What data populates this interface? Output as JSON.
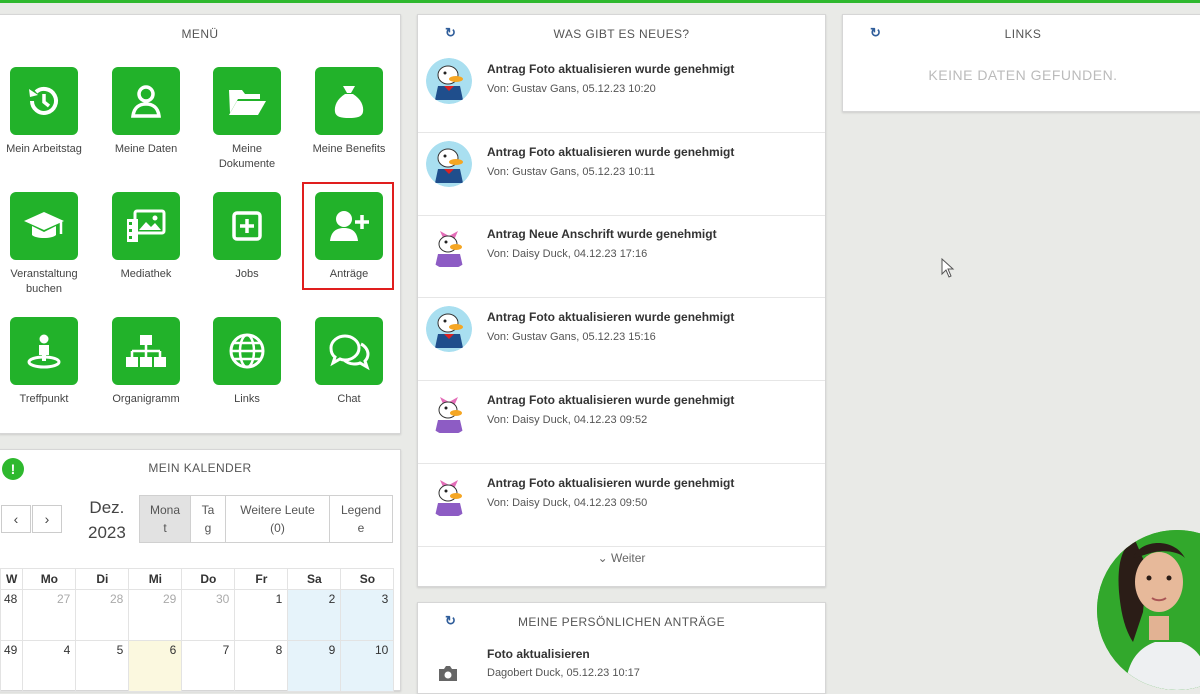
{
  "menu": {
    "title": "MENÜ",
    "items": [
      {
        "label": "Mein Arbeitstag",
        "icon": "history-icon"
      },
      {
        "label": "Meine Daten",
        "icon": "user-icon"
      },
      {
        "label": "Meine\nDokumente",
        "icon": "folder-icon"
      },
      {
        "label": "Meine Benefits",
        "icon": "money-bag-icon"
      },
      {
        "label": "Veranstaltung\nbuchen",
        "icon": "graduation-cap-icon"
      },
      {
        "label": "Mediathek",
        "icon": "media-icon"
      },
      {
        "label": "Jobs",
        "icon": "plus-square-icon"
      },
      {
        "label": "Anträge",
        "icon": "user-plus-icon"
      },
      {
        "label": "Treffpunkt",
        "icon": "meeting-point-icon"
      },
      {
        "label": "Organigramm",
        "icon": "org-chart-icon"
      },
      {
        "label": "Links",
        "icon": "globe-icon"
      },
      {
        "label": "Chat",
        "icon": "chat-icon"
      }
    ],
    "highlighted": "Anträge"
  },
  "calendar": {
    "title": "MEIN KALENDER",
    "info": "!",
    "prev": "‹",
    "next": "›",
    "month": "Dez.",
    "year": "2023",
    "views": {
      "monat": "Mona\nt",
      "tag": "Ta\ng",
      "weitere": "Weitere Leute\n(0)",
      "legende": "Legend\ne"
    },
    "headers": [
      "W",
      "Mo",
      "Di",
      "Mi",
      "Do",
      "Fr",
      "Sa",
      "So"
    ],
    "weeks": [
      [
        "48",
        "27",
        "28",
        "29",
        "30",
        "1",
        "2",
        "3"
      ],
      [
        "49",
        "4",
        "5",
        "6",
        "7",
        "8",
        "9",
        "10"
      ]
    ]
  },
  "news": {
    "title": "WAS GIBT ES NEUES?",
    "items": [
      {
        "title": "Antrag Foto aktualisieren wurde genehmigt",
        "sub": "Von: Gustav Gans, 05.12.23 10:20",
        "avatar": "gustav-avatar-icon"
      },
      {
        "title": "Antrag Foto aktualisieren wurde genehmigt",
        "sub": "Von: Gustav Gans, 05.12.23 10:11",
        "avatar": "gustav-avatar-icon"
      },
      {
        "title": "Antrag Neue Anschrift wurde genehmigt",
        "sub": "Von: Daisy Duck, 04.12.23 17:16",
        "avatar": "daisy-avatar-icon"
      },
      {
        "title": "Antrag Foto aktualisieren wurde genehmigt",
        "sub": "Von: Gustav Gans, 05.12.23 15:16",
        "avatar": "gustav-avatar-icon"
      },
      {
        "title": "Antrag Foto aktualisieren wurde genehmigt",
        "sub": "Von: Daisy Duck, 04.12.23 09:52",
        "avatar": "daisy-avatar-icon"
      },
      {
        "title": "Antrag Foto aktualisieren wurde genehmigt",
        "sub": "Von: Daisy Duck, 04.12.23 09:50",
        "avatar": "daisy-avatar-icon"
      }
    ],
    "more": "⌄ Weiter"
  },
  "links": {
    "title": "LINKS",
    "empty": "KEINE DATEN GEFUNDEN."
  },
  "antraege": {
    "title": "MEINE PERSÖNLICHEN ANTRÄGE",
    "items": [
      {
        "title": "Foto aktualisieren",
        "sub": "Dagobert Duck, 05.12.23 10:17"
      }
    ]
  },
  "colors": {
    "accent": "#22b22a",
    "highlight": "#e01e1e",
    "link": "#2f5d9a"
  }
}
